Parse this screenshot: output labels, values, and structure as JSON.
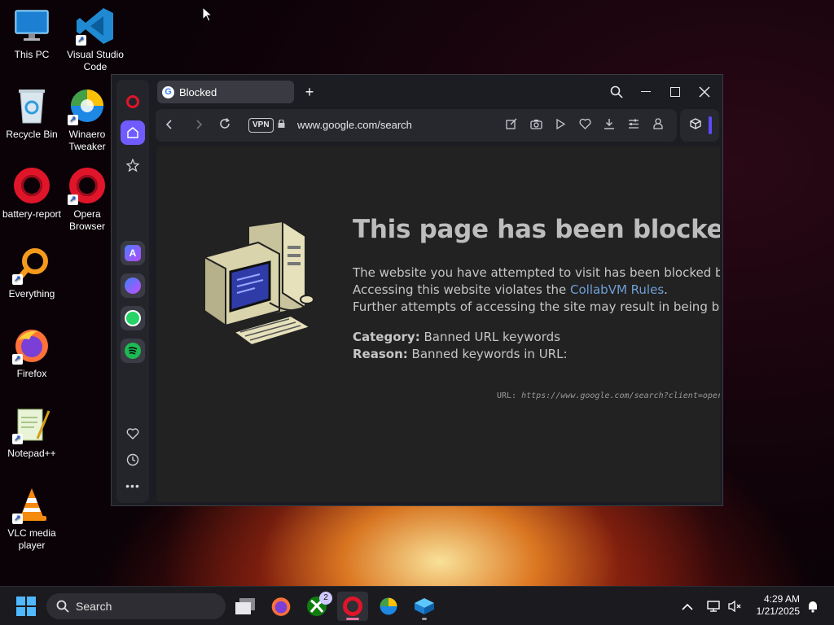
{
  "desktop": {
    "icons": [
      {
        "label": "This PC"
      },
      {
        "label": "Visual Studio Code"
      },
      {
        "label": "Recycle Bin"
      },
      {
        "label": "Winaero Tweaker"
      },
      {
        "label": "battery-report"
      },
      {
        "label": "Opera Browser"
      },
      {
        "label": "Everything"
      },
      {
        "label": "Firefox"
      },
      {
        "label": "Notepad++"
      },
      {
        "label": "VLC media player"
      }
    ]
  },
  "browser": {
    "tab": {
      "title": "Blocked",
      "favicon": "G"
    },
    "new_tab_glyph": "+",
    "address": {
      "vpn_label": "VPN",
      "url": "www.google.com/search"
    },
    "window_controls": {
      "search": "⌕",
      "minimize": "—",
      "maximize": "☐",
      "close": "✕"
    }
  },
  "page": {
    "headline": "This page has been blocked",
    "line1": "The website you have attempted to visit has been blocked by Co",
    "line2_prefix": "Accessing this website violates the ",
    "line2_link": "CollabVM Rules",
    "line2_suffix": ".",
    "line3": "Further attempts of accessing the site may result in being banne",
    "category_label": "Category:",
    "category_value": " Banned URL keywords",
    "reason_label": "Reason:",
    "reason_value": " Banned keywords in URL:",
    "url_label": "URL: ",
    "url_value": "https://www.google.com/search?client=oper"
  },
  "taskbar": {
    "search_placeholder": "Search",
    "xbox_badge": "2",
    "time": "4:29 AM",
    "date": "1/21/2025"
  },
  "colors": {
    "opera_red": "#e0152a",
    "sidebar_active": "#6f5bff",
    "link_blue": "#6f9fd8",
    "taskbar_bg": "#1b1b1f"
  }
}
